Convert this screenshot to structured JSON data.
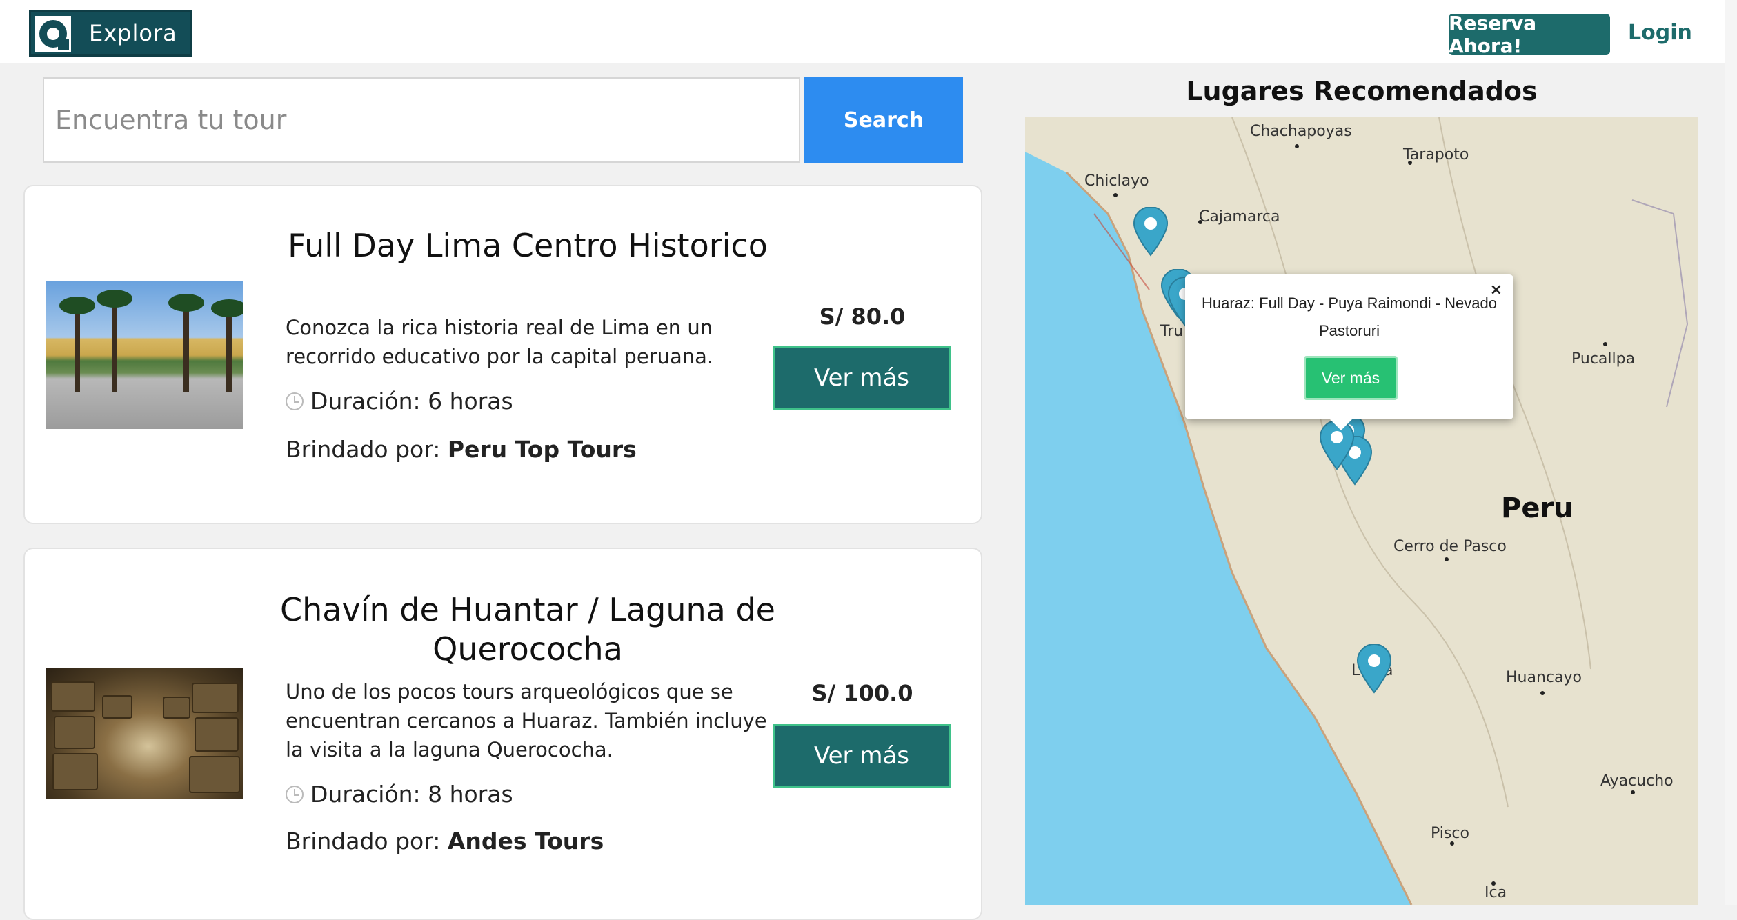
{
  "header": {
    "logo_text": "Explora",
    "reserve_label": "Reserva Ahora!",
    "login_label": "Login"
  },
  "search": {
    "placeholder": "Encuentra tu tour",
    "button_label": "Search"
  },
  "tours": [
    {
      "title": "Full Day Lima Centro Historico",
      "description": "Conozca la rica historia real de Lima en un recorrido educativo por la capital peruana.",
      "duration": "Duración: 6 horas",
      "provider_label": "Brindado por:",
      "provider": "Peru Top Tours",
      "price": "S/ 80.0",
      "button_label": "Ver más"
    },
    {
      "title": "Chavín de Huantar / Laguna de Querococha",
      "description": "Uno de los pocos tours arqueológicos que se encuentran cercanos a Huaraz. También incluye la visita a la laguna Querococha.",
      "duration": "Duración: 8 horas",
      "provider_label": "Brindado por:",
      "provider": "Andes Tours",
      "price": "S/ 100.0",
      "button_label": "Ver más"
    }
  ],
  "map": {
    "title": "Lugares Recomendados",
    "country_label": "Peru",
    "cities": [
      "Chachapoyas",
      "Tarapoto",
      "Chiclayo",
      "Cajamarca",
      "Tru",
      "Pucallpa",
      "Cerro de Pasco",
      "L",
      "a",
      "Huancayo",
      "Ayacucho",
      "Pisco",
      "Ica"
    ],
    "popup": {
      "text": "Huaraz: Full Day - Puya Raimondi - Nevado Pastoruri",
      "close_label": "×",
      "button_label": "Ver más"
    },
    "colors": {
      "ocean": "#7ecfee",
      "land": "#e7e2cf",
      "pin": "#3aa6c9",
      "popup_button": "#27c173"
    }
  }
}
